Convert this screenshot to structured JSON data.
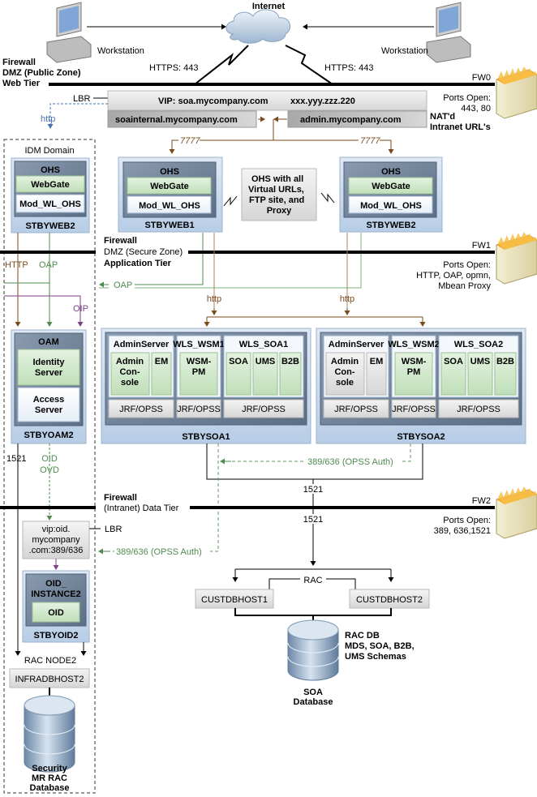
{
  "internet": {
    "label": "Internet"
  },
  "workstations": [
    {
      "label": "Workstation"
    },
    {
      "label": "Workstation"
    }
  ],
  "links": {
    "https_left": "HTTPS: 443",
    "https_right": "HTTPS: 443",
    "port_7777_left": "7777",
    "port_7777_right": "7777",
    "http_idm": "http",
    "http_ohs1": "http",
    "http_ohs2": "http",
    "http_caps": "HTTP",
    "oap_left": "OAP",
    "oap_arrow": "OAP",
    "oip": "OIP",
    "oid": "OID",
    "ovd": "OVD",
    "port_1521_left": "1521",
    "port_1521_upper": "1521",
    "port_1521_lower": "1521",
    "opss_auth_upper": "389/636 (OPSS Auth)",
    "opss_auth_lower": "389/636 (OPSS Auth)",
    "rac": "RAC",
    "rac_node2": "RAC NODE2",
    "lbr_top": "LBR",
    "lbr_oid": "LBR"
  },
  "firewalls": [
    {
      "id": "FW0",
      "title": [
        "Firewall",
        "DMZ (Public Zone)",
        "Web Tier"
      ],
      "ports_label": "Ports Open:",
      "ports": [
        "443, 80"
      ]
    },
    {
      "id": "FW1",
      "title": [
        "Firewall",
        "DMZ (Secure Zone)",
        "Application Tier"
      ],
      "ports_label": "Ports Open:",
      "ports": [
        "HTTP, OAP, opmn,",
        "Mbean Proxy"
      ]
    },
    {
      "id": "FW2",
      "title": [
        "Firewall",
        "(Intranet) Data Tier"
      ],
      "ports_label": "Ports Open:",
      "ports": [
        "389, 636,1521"
      ]
    }
  ],
  "load_balancer": {
    "vip": "VIP: soa.mycompany.com",
    "ip": "xxx.yyy.zzz.220",
    "internal_url": "soainternal.mycompany.com",
    "admin_url": "admin.mycompany.com",
    "nat_note": [
      "NAT'd",
      "Intranet URL's"
    ]
  },
  "idm_domain": {
    "label": "IDM Domain",
    "web_host": {
      "name": "STBYWEB2",
      "ohs": "OHS",
      "webgate": "WebGate",
      "mod": "Mod_WL_OHS"
    },
    "oam_host": {
      "name": "STBYOAM2",
      "title": "OAM",
      "identity": [
        "Identity",
        "Server"
      ],
      "access": [
        "Access",
        "Server"
      ]
    },
    "oid_vip": [
      "vip:oid.",
      "mycompany",
      ".com:389/636"
    ],
    "oid_host": {
      "name": "STBYOID2",
      "title": [
        "OID_",
        "INSTANCE2"
      ],
      "oid": "OID"
    },
    "db_host": "INFRADBHOST2",
    "db_label": [
      "Security",
      "MR RAC",
      "Database"
    ]
  },
  "web_hosts": [
    {
      "name": "STBYWEB1",
      "ohs": "OHS",
      "webgate": "WebGate",
      "mod": "Mod_WL_OHS"
    },
    {
      "name": "STBYWEB2",
      "ohs": "OHS",
      "webgate": "WebGate",
      "mod": "Mod_WL_OHS"
    }
  ],
  "ohs_note": [
    "OHS with all",
    "Virtual URLs,",
    "FTP site, and",
    "Proxy"
  ],
  "soa_hosts": [
    {
      "name": "STBYSOA1",
      "admin": {
        "title": "AdminServer",
        "console": [
          "Admin",
          "Con-",
          "sole"
        ],
        "em": "EM",
        "jrf": "JRF/OPSS",
        "active": true
      },
      "wsm": {
        "title": "WLS_WSM1",
        "pm": [
          "WSM-",
          "PM"
        ],
        "jrf": "JRF/OPSS"
      },
      "soa": {
        "title": "WLS_SOA1",
        "apps": [
          "SOA",
          "UMS",
          "B2B"
        ],
        "jrf": "JRF/OPSS"
      }
    },
    {
      "name": "STBYSOA2",
      "admin": {
        "title": "AdminServer",
        "console": [
          "Admin",
          "Con-",
          "sole"
        ],
        "em": "EM",
        "jrf": "JRF/OPSS",
        "active": false
      },
      "wsm": {
        "title": "WLS_WSM2",
        "pm": [
          "WSM-",
          "PM"
        ],
        "jrf": "JRF/OPSS"
      },
      "soa": {
        "title": "WLS_SOA2",
        "apps": [
          "SOA",
          "UMS",
          "B2B"
        ],
        "jrf": "JRF/OPSS"
      }
    }
  ],
  "db_hosts": [
    "CUSTDBHOST1",
    "CUSTDBHOST2"
  ],
  "soa_db": {
    "label": [
      "SOA",
      "Database"
    ],
    "note": [
      "RAC DB",
      "MDS, SOA, B2B,",
      "UMS Schemas"
    ]
  },
  "colors": {
    "http_line": "#8a5a2e",
    "oap_line": "#5f9a5f",
    "oip_line": "#8e4f98",
    "ldap_dashed": "#5f9a5f",
    "idm_http": "#4a74b0",
    "host_panel": "#c9dbee",
    "component_green": "#cfe8c9"
  }
}
